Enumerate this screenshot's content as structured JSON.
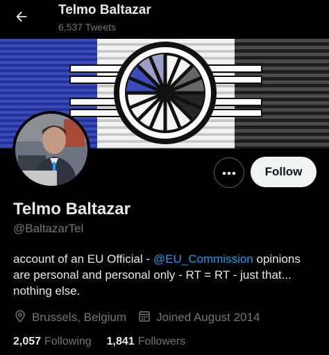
{
  "header": {
    "title": "Telmo Baltazar",
    "subtitle": "6,537 Tweets"
  },
  "profile": {
    "display_name": "Telmo Baltazar",
    "handle": "@BaltazarTel",
    "bio_prefix": "account of an EU Official - ",
    "bio_mention": "@EU_Commission",
    "bio_suffix": " opinions are personal and personal only - RT = RT - just that... nothing else.",
    "location": "Brussels, Belgium",
    "joined": "Joined August 2014"
  },
  "actions": {
    "follow_label": "Follow",
    "more_icon": "more-icon"
  },
  "stats": {
    "following_count": "2,057",
    "following_label": "Following",
    "followers_count": "1,841",
    "followers_label": "Followers"
  },
  "colors": {
    "background": "#000000",
    "text_primary": "#e7e9ea",
    "text_secondary": "#71767b",
    "link": "#1d9bf0",
    "follow_button": "#eff3f4",
    "banner_blue": "#3b4bb8"
  }
}
